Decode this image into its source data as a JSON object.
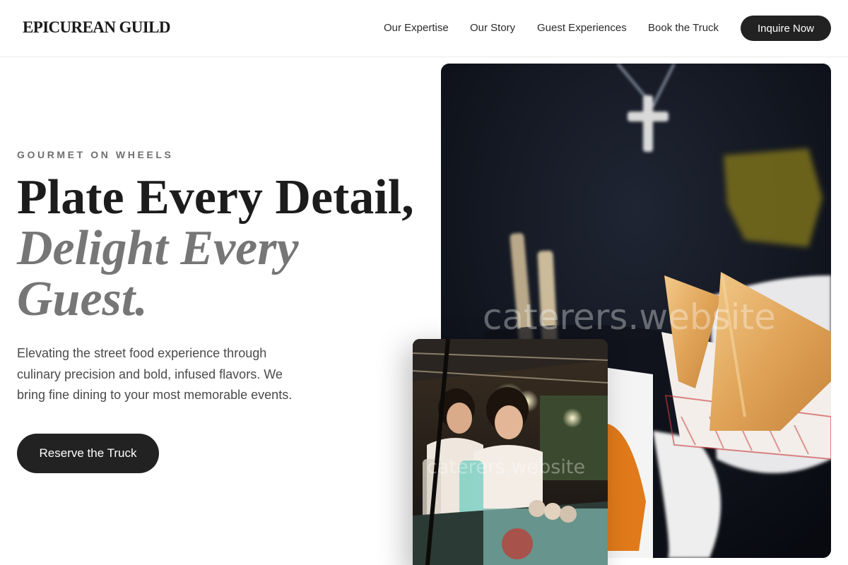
{
  "header": {
    "logo": "EPICUREAN GUILD",
    "nav": [
      {
        "label": "Our Expertise"
      },
      {
        "label": "Our Story"
      },
      {
        "label": "Guest Experiences"
      },
      {
        "label": "Book the Truck"
      }
    ],
    "cta_label": "Inquire Now"
  },
  "hero": {
    "eyebrow": "GOURMET ON WHEELS",
    "headline_line1": "Plate Every Detail,",
    "headline_line2": "Delight Every",
    "headline_line3": "Guest.",
    "description_lines": [
      "Elevating the street food experience through",
      "culinary precision and bold, infused flavors. We",
      "bring fine dining to your most memorable events."
    ],
    "cta_label": "Reserve the Truck"
  },
  "images": {
    "main_watermark": "caterers.website",
    "secondary_watermark": "caterers.website"
  },
  "colors": {
    "primary_button": "#222222",
    "accent_text": "#767676"
  }
}
